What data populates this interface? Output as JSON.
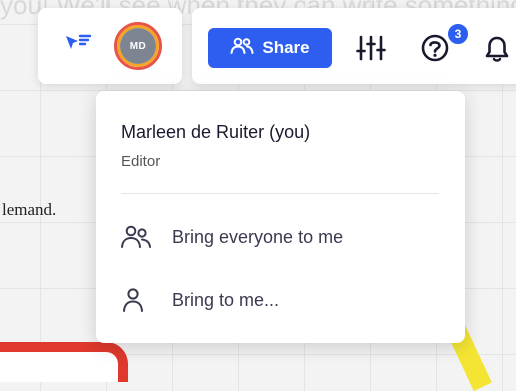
{
  "background": {
    "top_text": "you! We'll see when they can write something on the board!",
    "doc_text": "lemand."
  },
  "toolbar_left": {
    "cursor_icon": "cursor-follow-icon",
    "avatar_initials": "MD"
  },
  "toolbar_right": {
    "share_label": "Share",
    "share_icon": "people-icon",
    "settings_icon": "sliders-icon",
    "help_icon": "help-icon",
    "help_badge": "3",
    "notification_icon": "bell-icon"
  },
  "user_menu": {
    "name": "Marleen de Ruiter (you)",
    "role": "Editor",
    "items": [
      {
        "label": "Bring everyone to me",
        "icon": "people-icon"
      },
      {
        "label": "Bring to me...",
        "icon": "person-icon"
      }
    ]
  },
  "colors": {
    "accent": "#2d5ef0",
    "avatar_ring": "#e8544a",
    "avatar_bg": "#7d8593"
  }
}
